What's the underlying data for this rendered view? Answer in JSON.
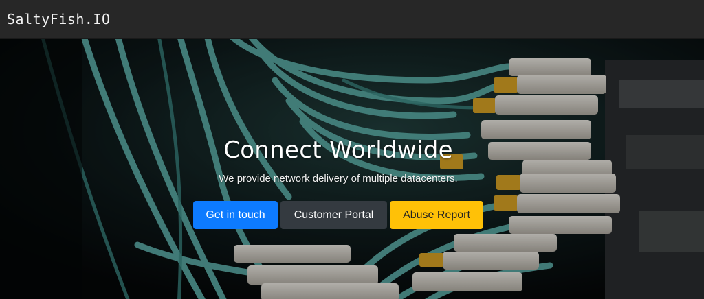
{
  "navbar": {
    "brand": "SaltyFish.IO"
  },
  "hero": {
    "headline": "Connect Worldwide",
    "subtext": "We provide network delivery of multiple datacenters.",
    "buttons": {
      "get_in_touch": "Get in touch",
      "customer_portal": "Customer Portal",
      "abuse_report": "Abuse Report"
    }
  },
  "colors": {
    "navbar_bg": "#272727",
    "primary": "#0d7bff",
    "dark": "#343a40",
    "warning": "#ffc107",
    "cable_teal": "#5fb3ad",
    "connector_yellow": "#e0a826"
  }
}
